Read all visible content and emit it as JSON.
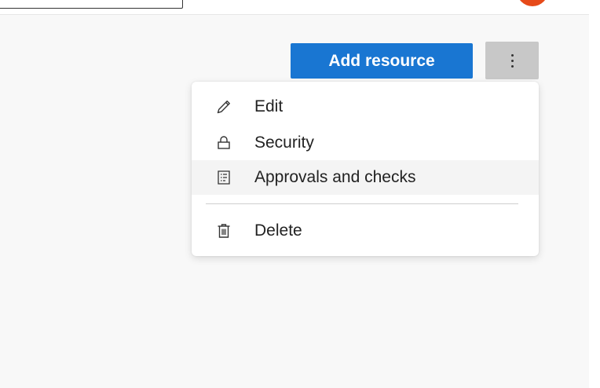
{
  "header": {
    "search_value": ""
  },
  "toolbar": {
    "add_resource_label": "Add resource",
    "add_resource_color": "#1976d2",
    "more_actions_icon": "more-vertical-icon"
  },
  "menu": {
    "items": [
      {
        "label": "Edit",
        "icon": "pencil-icon"
      },
      {
        "label": "Security",
        "icon": "lock-icon"
      },
      {
        "label": "Approvals and checks",
        "icon": "checklist-icon",
        "highlighted": true
      },
      {
        "label": "Delete",
        "icon": "trash-icon"
      }
    ]
  },
  "colors": {
    "avatar": "#e64a19",
    "content_background": "#f8f8f8",
    "menu_hover": "#f4f4f4"
  }
}
